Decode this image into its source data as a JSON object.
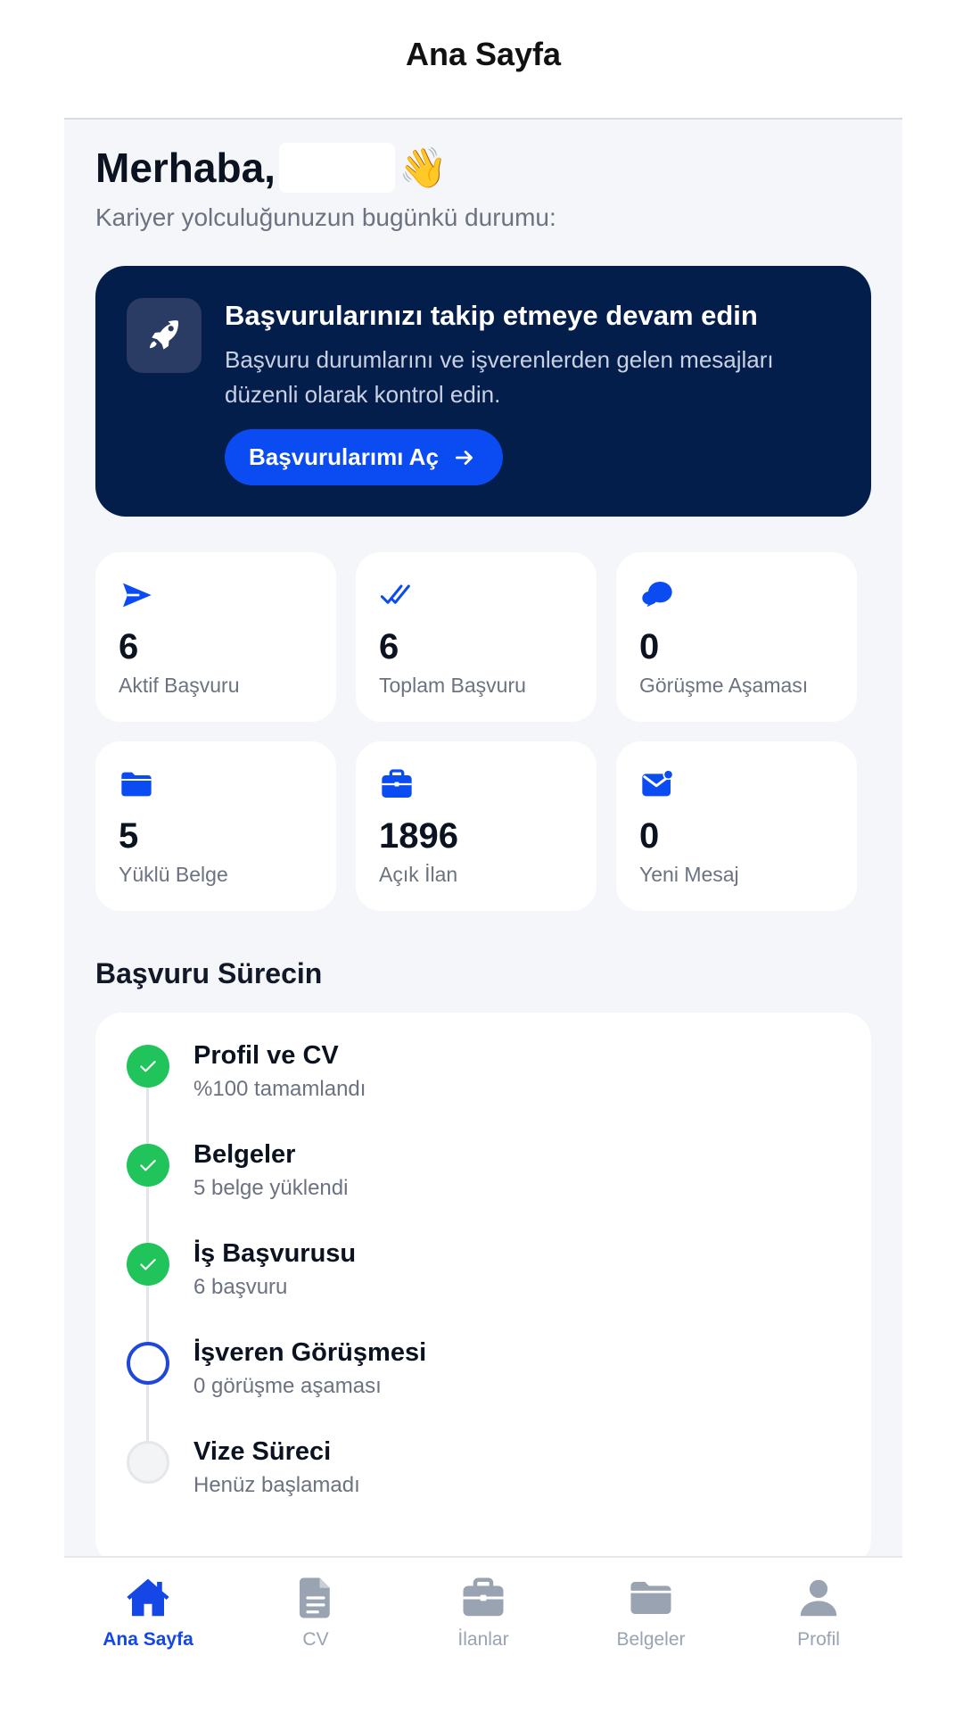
{
  "header": {
    "title": "Ana Sayfa"
  },
  "greeting": {
    "text": "Merhaba,",
    "emoji": "👋",
    "subtitle": "Kariyer yolculuğunuzun bugünkü durumu:"
  },
  "banner": {
    "title": "Başvurularınızı takip etmeye devam edin",
    "description": "Başvuru durumlarını ve işverenlerden gelen mesajları düzenli olarak kontrol edin.",
    "button_label": "Başvurularımı Aç",
    "icon": "rocket-icon"
  },
  "stats": [
    {
      "icon": "send-icon",
      "value": "6",
      "label": "Aktif Başvuru"
    },
    {
      "icon": "double-check-icon",
      "value": "6",
      "label": "Toplam Başvuru"
    },
    {
      "icon": "chat-bubbles-icon",
      "value": "0",
      "label": "Görüşme Aşaması"
    },
    {
      "icon": "folder-icon",
      "value": "5",
      "label": "Yüklü Belge"
    },
    {
      "icon": "briefcase-icon",
      "value": "1896",
      "label": "Açık İlan"
    },
    {
      "icon": "mail-badge-icon",
      "value": "0",
      "label": "Yeni Mesaj"
    }
  ],
  "process": {
    "title": "Başvuru Sürecin",
    "steps": [
      {
        "title": "Profil ve CV",
        "subtitle": "%100 tamamlandı",
        "status": "done"
      },
      {
        "title": "Belgeler",
        "subtitle": "5 belge yüklendi",
        "status": "done"
      },
      {
        "title": "İş Başvurusu",
        "subtitle": "6 başvuru",
        "status": "done"
      },
      {
        "title": "İşveren Görüşmesi",
        "subtitle": "0 görüşme aşaması",
        "status": "current"
      },
      {
        "title": "Vize Süreci",
        "subtitle": "Henüz başlamadı",
        "status": "pending"
      }
    ]
  },
  "nav": [
    {
      "label": "Ana Sayfa",
      "icon": "home-icon",
      "active": true
    },
    {
      "label": "CV",
      "icon": "document-icon",
      "active": false
    },
    {
      "label": "İlanlar",
      "icon": "briefcase-icon",
      "active": false
    },
    {
      "label": "Belgeler",
      "icon": "folder-icon",
      "active": false
    },
    {
      "label": "Profil",
      "icon": "user-icon",
      "active": false
    }
  ],
  "colors": {
    "primary": "#0b4bf2",
    "banner_bg": "#041e4c",
    "success": "#21c45a",
    "nav_inactive": "#9aa3b2",
    "background": "#f5f6fa"
  }
}
